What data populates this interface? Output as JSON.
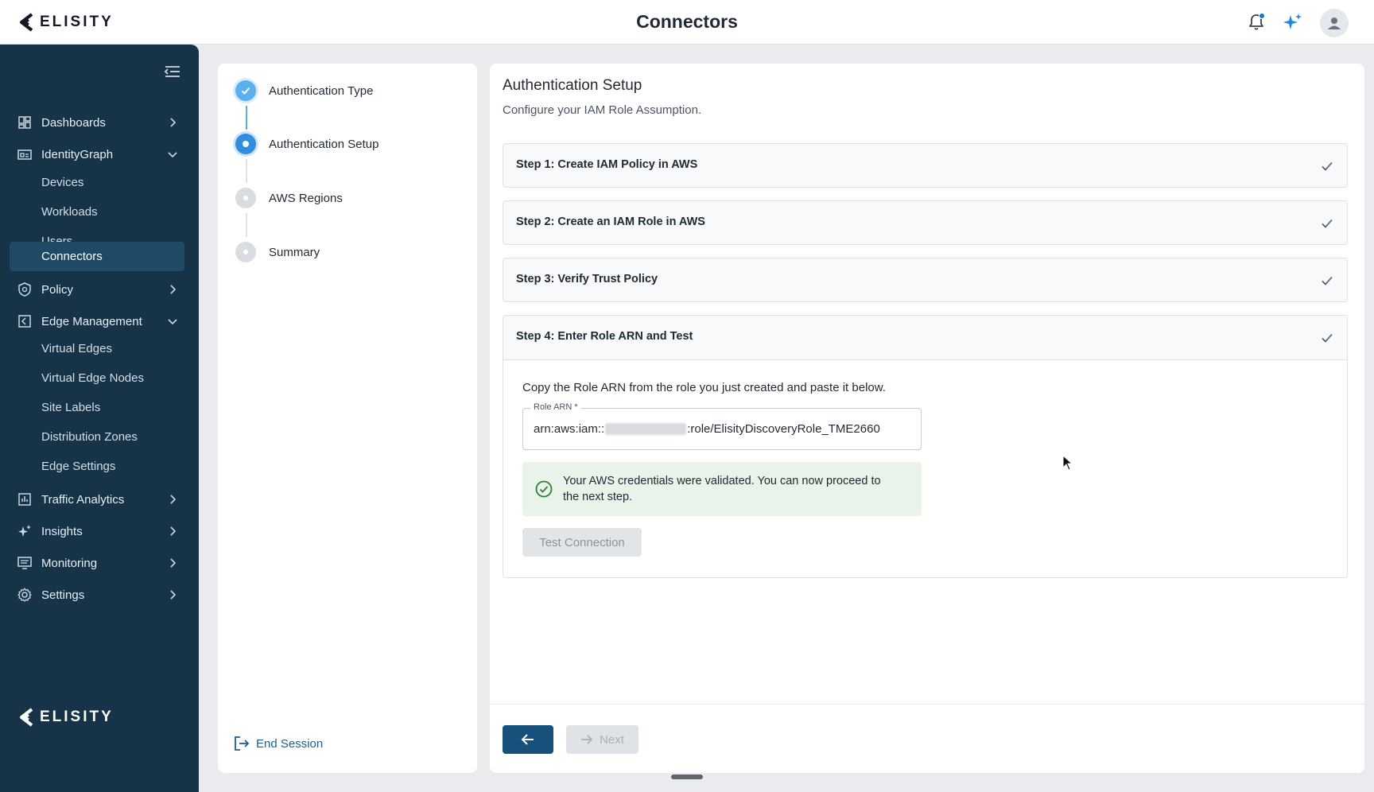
{
  "header": {
    "brand": "ELISITY",
    "title": "Connectors"
  },
  "sidebar": {
    "brand": "ELISITY",
    "items": [
      {
        "label": "Dashboards",
        "icon": "dashboard-grid-icon",
        "expanded": false
      },
      {
        "label": "IdentityGraph",
        "icon": "identity-graph-icon",
        "expanded": true,
        "children": [
          "Devices",
          "Workloads",
          "Users",
          "Connectors"
        ]
      },
      {
        "label": "Policy",
        "icon": "shield-icon",
        "expanded": false
      },
      {
        "label": "Edge Management",
        "icon": "edge-icon",
        "expanded": true,
        "children": [
          "Virtual Edges",
          "Virtual Edge Nodes",
          "Site Labels",
          "Distribution Zones",
          "Edge Settings"
        ]
      },
      {
        "label": "Traffic Analytics",
        "icon": "chart-icon",
        "expanded": false
      },
      {
        "label": "Insights",
        "icon": "sparkle-icon",
        "expanded": false
      },
      {
        "label": "Monitoring",
        "icon": "monitor-icon",
        "expanded": false
      },
      {
        "label": "Settings",
        "icon": "gear-icon",
        "expanded": false
      }
    ],
    "active": "Connectors"
  },
  "stepper": {
    "steps": [
      {
        "label": "Authentication Type",
        "state": "done"
      },
      {
        "label": "Authentication Setup",
        "state": "current"
      },
      {
        "label": "AWS Regions",
        "state": "pending"
      },
      {
        "label": "Summary",
        "state": "pending"
      }
    ],
    "end_session": "End Session"
  },
  "main": {
    "title": "Authentication Setup",
    "subtitle": "Configure your IAM Role Assumption.",
    "accordions": [
      {
        "title": "Step 1: Create IAM Policy in AWS",
        "complete": true
      },
      {
        "title": "Step 2: Create an IAM Role in AWS",
        "complete": true
      },
      {
        "title": "Step 3: Verify Trust Policy",
        "complete": true
      },
      {
        "title": "Step 4: Enter Role ARN and Test",
        "complete": true,
        "expanded": true
      }
    ],
    "step4": {
      "instruction": "Copy the Role ARN from the role you just created and paste it below.",
      "field_label": "Role ARN *",
      "value_prefix": "arn:aws:iam::",
      "value_suffix": ":role/ElisityDiscoveryRole_TME2660",
      "success_message": "Your AWS credentials were validated. You can now proceed to the next step.",
      "test_button": "Test Connection"
    },
    "next_button": "Next"
  },
  "colors": {
    "sidebar_bg": "#163347",
    "primary": "#17507a",
    "step_blue": "#2f8fdc",
    "success_bg": "#e9f3e9",
    "success_icon": "#2e7d32"
  }
}
